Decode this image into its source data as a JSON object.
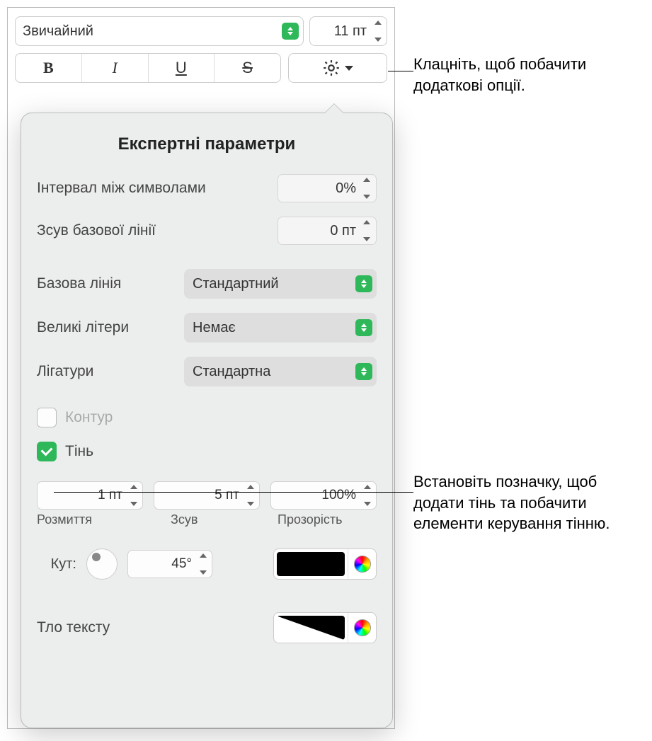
{
  "toolbar": {
    "font_style": "Звичайний",
    "font_size": "11 пт"
  },
  "popover": {
    "title": "Експертні параметри",
    "char_spacing": {
      "label": "Інтервал між символами",
      "value": "0%"
    },
    "baseline_shift": {
      "label": "Зсув базової лінії",
      "value": "0 пт"
    },
    "baseline": {
      "label": "Базова лінія",
      "value": "Стандартний"
    },
    "capitals": {
      "label": "Великі літери",
      "value": "Немає"
    },
    "ligatures": {
      "label": "Лігатури",
      "value": "Стандартна"
    },
    "outline": {
      "label": "Контур",
      "checked": false
    },
    "shadow": {
      "label": "Тінь",
      "checked": true,
      "blur": {
        "value": "1 пт",
        "label": "Розмиття"
      },
      "offset": {
        "value": "5 пт",
        "label": "Зсув"
      },
      "opacity": {
        "value": "100%",
        "label": "Прозорість"
      },
      "angle": {
        "label": "Кут:",
        "value": "45°"
      }
    },
    "text_bg": {
      "label": "Тло тексту"
    }
  },
  "annotations": {
    "gear": "Клацніть, щоб побачити додаткові опції.",
    "shadow": "Встановіть позначку, щоб додати тінь та побачити елементи керування тінню."
  }
}
